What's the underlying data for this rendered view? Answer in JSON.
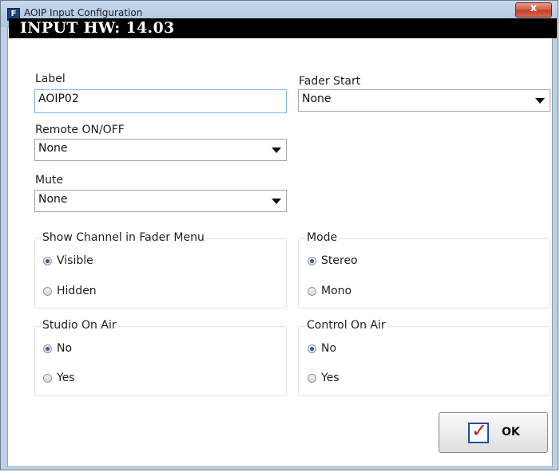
{
  "window": {
    "title": "AOIP Input Configuration",
    "app_icon": "F",
    "close_glyph": "x"
  },
  "header": {
    "text": "INPUT HW: 14.03"
  },
  "label_field": {
    "label": "Label",
    "value": "AOIP02"
  },
  "fader_start": {
    "label": "Fader Start",
    "value": "None"
  },
  "remote_onoff": {
    "label": "Remote ON/OFF",
    "value": "None"
  },
  "mute": {
    "label": "Mute",
    "value": "None"
  },
  "groups": {
    "show_channel": {
      "title": "Show Channel in Fader Menu",
      "options": [
        "Visible",
        "Hidden"
      ],
      "selected": 0
    },
    "mode": {
      "title": "Mode",
      "options": [
        "Stereo",
        "Mono"
      ],
      "selected": 0
    },
    "studio_on_air": {
      "title": "Studio On Air",
      "options": [
        "No",
        "Yes"
      ],
      "selected": 0
    },
    "control_on_air": {
      "title": "Control On Air",
      "options": [
        "No",
        "Yes"
      ],
      "selected": 0
    }
  },
  "ok_button": {
    "label": "OK",
    "icon": "checkmark-icon"
  },
  "colors": {
    "header_bg": "#000000",
    "header_text": "#ffffff",
    "checkmark": "#c41b1b",
    "check_border": "#1f4fa3",
    "close_button": "#c1402a"
  }
}
